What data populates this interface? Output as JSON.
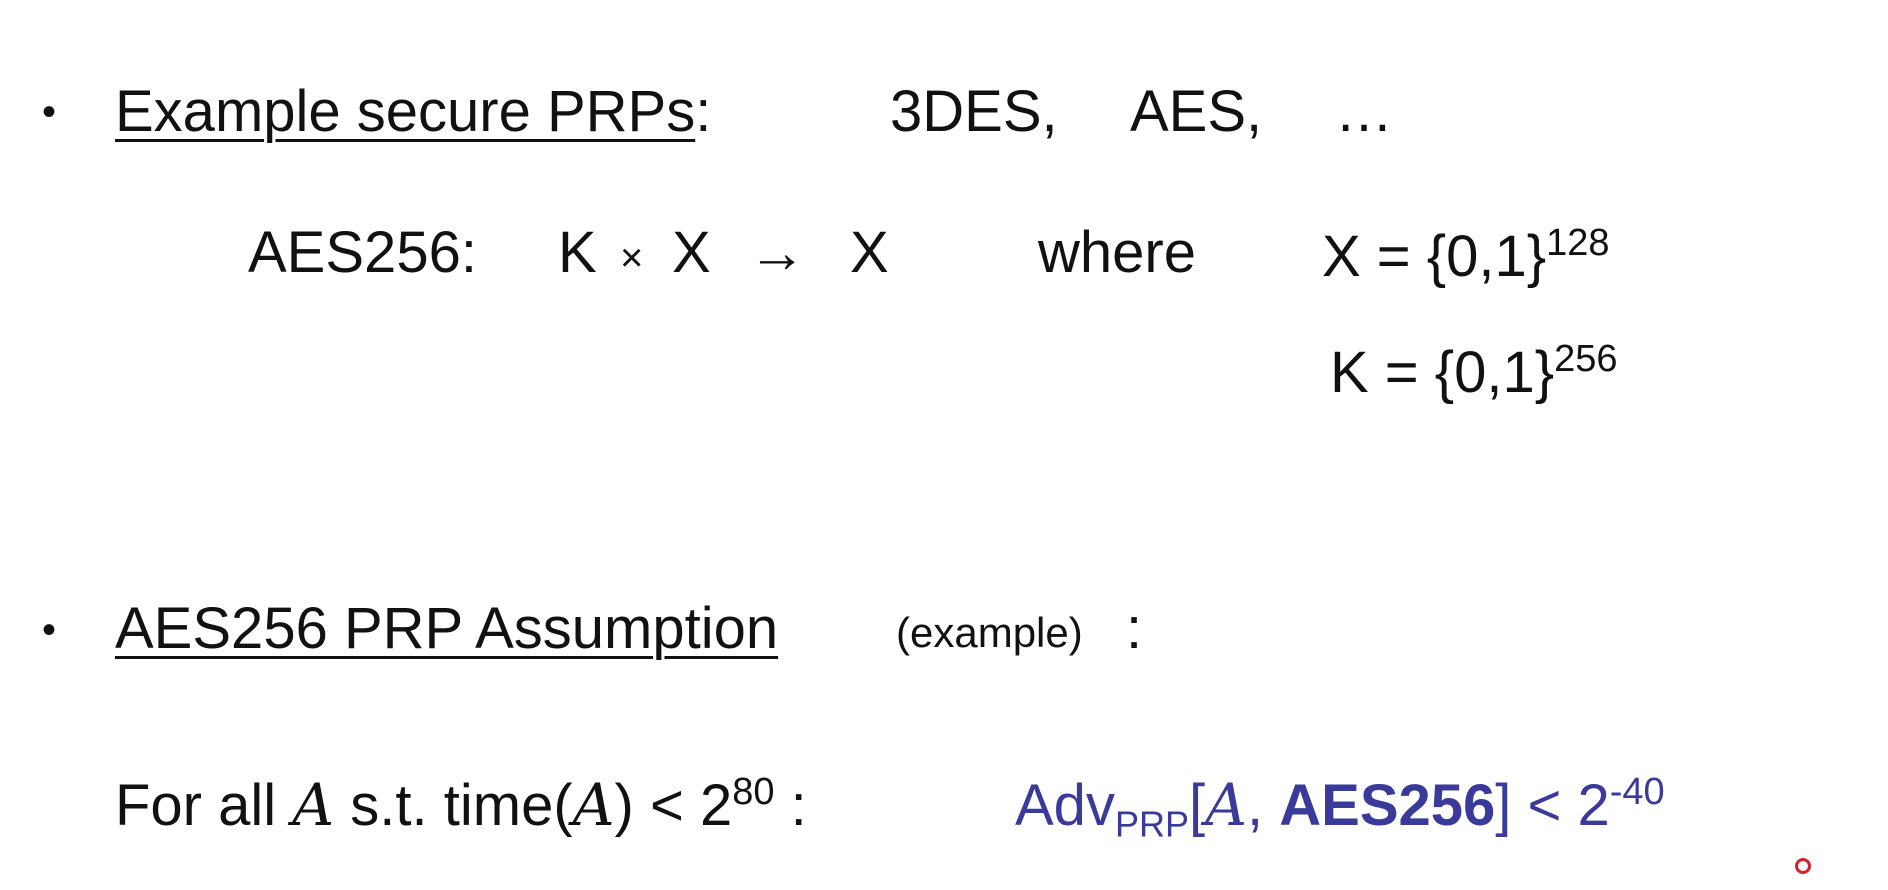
{
  "slide": {
    "bullet_glyph": "•",
    "item1": {
      "heading": "Example secure PRPs",
      "colon": ":",
      "examples": [
        "3DES,",
        "AES,",
        "…"
      ],
      "aes_line": {
        "label": "AES256:",
        "k": "K",
        "times": "×",
        "x": "X",
        "arrow": "→",
        "x2": "X",
        "where": "where",
        "xdef": "X = {0,1}",
        "xexp": "128",
        "kdef": "K = {0,1}",
        "kexp": "256"
      }
    },
    "item2": {
      "heading": "AES256 PRP Assumption",
      "note": "(example)",
      "colon": ":",
      "forall": "For all",
      "A": "A",
      "st_time": "s.t. time(",
      "lt": ") < 2",
      "time_exp": "80",
      "colon2": ":",
      "adv": "Adv",
      "adv_sub": "PRP",
      "lbr": "[",
      "comma": ",",
      "aes": "AES256",
      "rbr": "]",
      "lt2": " < 2",
      "adv_exp": "-40"
    },
    "colors": {
      "text": "#111111",
      "accent": "#3a3a9a",
      "pointer": "#d2232a"
    }
  }
}
